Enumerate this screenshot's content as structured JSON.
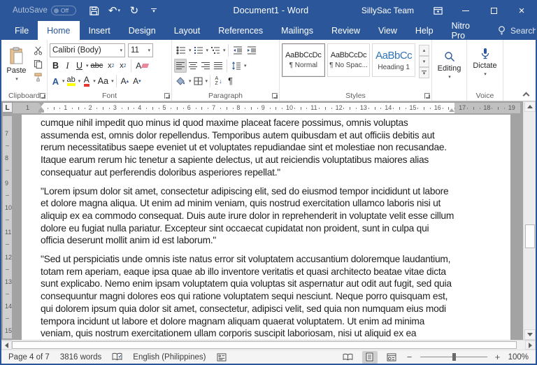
{
  "colors": {
    "accent": "#2b579a",
    "heading_style_blue": "#2e74b5",
    "highlight_yellow": "#ffff00",
    "font_color_red": "#e03c31",
    "title_bar": "#2b579a"
  },
  "icons": {
    "dropdown": "▾",
    "up_arrow": "▴",
    "undo": "↶",
    "redo": "↻",
    "close": "×",
    "down_arrow": "↓",
    "sort_a": "A",
    "sort_z": "Z",
    "pilcrow": "¶"
  },
  "title_bar": {
    "autosave_label": "AutoSave",
    "autosave_state": "Off",
    "title": "Document1 - Word",
    "account": "SillySac Team"
  },
  "tabs": [
    "File",
    "Home",
    "Insert",
    "Design",
    "Layout",
    "References",
    "Mailings",
    "Review",
    "View",
    "Help",
    "Nitro Pro"
  ],
  "search": {
    "label": "Search"
  },
  "ribbon": {
    "clipboard": {
      "group_label": "Clipboard",
      "paste_label": "Paste"
    },
    "font": {
      "group_label": "Font",
      "font_name": "Calibri (Body)",
      "font_size": "11",
      "bold": "B",
      "italic": "I",
      "underline": "U",
      "strikethrough": "abc",
      "sub_base": "x",
      "sub_mark": "2",
      "sup_base": "x",
      "sup_mark": "2",
      "clear_letter": "A",
      "text_effects": "A",
      "highlight": "ab",
      "font_color": "A",
      "change_case": "Aa",
      "grow": "A",
      "shrink": "A"
    },
    "paragraph": {
      "group_label": "Paragraph"
    },
    "styles": {
      "group_label": "Styles",
      "items": [
        {
          "preview": "AaBbCcDc",
          "name": "¶ Normal"
        },
        {
          "preview": "AaBbCcDc",
          "name": "¶ No Spac..."
        },
        {
          "preview": "AaBbCc",
          "name": "Heading 1"
        }
      ]
    },
    "editing": {
      "label": "Editing"
    },
    "voice": {
      "group_label": "Voice",
      "dictate_label": "Dictate"
    }
  },
  "ruler": {
    "tab_selector": "L",
    "margin_number": "1",
    "numbers": [
      1,
      2,
      3,
      4,
      5,
      6,
      7,
      8,
      9,
      10,
      11,
      12,
      13,
      14,
      15,
      16,
      17,
      18,
      19
    ],
    "vertical_numbers": [
      7,
      8,
      9,
      10,
      11,
      12,
      13,
      14,
      15
    ]
  },
  "document": {
    "paragraphs": [
      "cumque nihil impedit quo minus id quod maxime placeat facere possimus, omnis voluptas assumenda est, omnis dolor repellendus. Temporibus autem quibusdam et aut officiis debitis aut rerum necessitatibus saepe eveniet ut et voluptates repudiandae sint et molestiae non recusandae. Itaque earum rerum hic tenetur a sapiente delectus, ut aut reiciendis voluptatibus maiores alias consequatur aut perferendis doloribus asperiores repellat.\"",
      "\"Lorem ipsum dolor sit amet, consectetur adipiscing elit, sed do eiusmod tempor incididunt ut labore et dolore magna aliqua. Ut enim ad minim veniam, quis nostrud exercitation ullamco laboris nisi ut aliquip ex ea commodo consequat. Duis aute irure dolor in reprehenderit in voluptate velit esse cillum dolore eu fugiat nulla pariatur. Excepteur sint occaecat cupidatat non proident, sunt in culpa qui officia deserunt mollit anim id est laborum.\"",
      "\"Sed ut perspiciatis unde omnis iste natus error sit voluptatem accusantium doloremque laudantium, totam rem aperiam, eaque ipsa quae ab illo inventore veritatis et quasi architecto beatae vitae dicta sunt explicabo. Nemo enim ipsam voluptatem quia voluptas sit aspernatur aut odit aut fugit, sed quia consequuntur magni dolores eos qui ratione voluptatem sequi nesciunt. Neque porro quisquam est, qui dolorem ipsum quia dolor sit amet, consectetur, adipisci velit, sed quia non numquam eius modi tempora incidunt ut labore et dolore magnam aliquam quaerat voluptatem. Ut enim ad minima veniam, quis nostrum exercitationem ullam corporis suscipit laboriosam, nisi ut aliquid ex ea commodi consequatur? Quis autem vel eum iure reprehenderit qui in ea voluptate velit esse quam nihil molestiae"
    ]
  },
  "status_bar": {
    "page": "Page 4 of 7",
    "words": "3816 words",
    "language": "English (Philippines)",
    "zoom_out": "−",
    "zoom_in": "+",
    "zoom": "100%"
  }
}
